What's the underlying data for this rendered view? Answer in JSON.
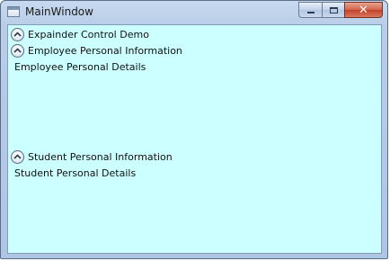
{
  "window": {
    "title": "MainWindow",
    "client_background": "#ccffff",
    "minimize_icon": "minimize-icon",
    "maximize_icon": "maximize-icon",
    "close_icon": "close-icon",
    "close_glyph": "✕"
  },
  "expanders": [
    {
      "header": "Expainder Control Demo",
      "expanded": true,
      "content": ""
    },
    {
      "header": "Employee Personal Information",
      "expanded": true,
      "content": "Employee Personal Details"
    },
    {
      "header": "Student Personal Information",
      "expanded": true,
      "content": "Student Personal Details"
    }
  ]
}
